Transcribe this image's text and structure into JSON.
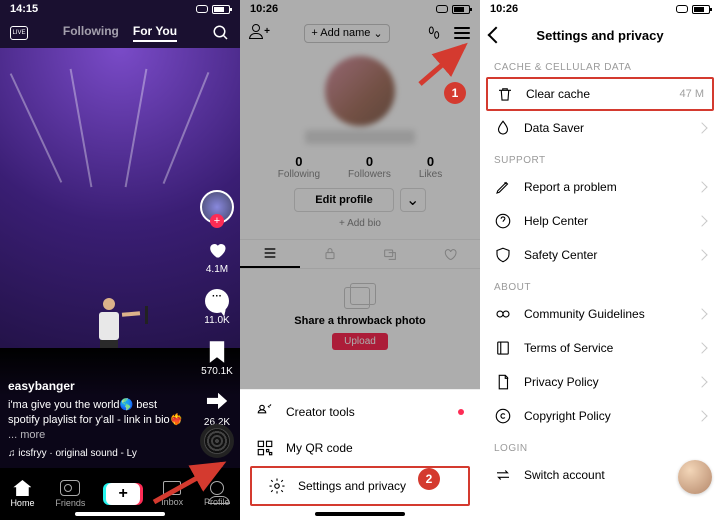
{
  "pane1": {
    "time": "14:15",
    "tabs": {
      "following": "Following",
      "foryou": "For You"
    },
    "rail": {
      "likes": "4.1M",
      "comments": "11.0K",
      "bookmarks": "570.1K",
      "shares": "26.2K"
    },
    "caption": {
      "user": "easybanger",
      "text": "i'ma give you the world🌎 best spotify playlist for y'all - link in bio❤️‍🔥 ",
      "more": "... more",
      "sound": "♫ icsfryy · original sound - Ly"
    },
    "nav": {
      "home": "Home",
      "friends": "Friends",
      "inbox": "Inbox",
      "profile": "Profile"
    }
  },
  "pane2": {
    "time": "10:26",
    "addname": "+ Add name",
    "stats": {
      "following_n": "0",
      "following_l": "Following",
      "followers_n": "0",
      "followers_l": "Followers",
      "likes_n": "0",
      "likes_l": "Likes"
    },
    "edit": "Edit profile",
    "addbio": "+ Add bio",
    "throw_title": "Share a throwback photo",
    "upload": "Upload",
    "sheet": {
      "creator": "Creator tools",
      "qrcode": "My QR code",
      "settings": "Settings and privacy"
    }
  },
  "pane3": {
    "time": "10:26",
    "title": "Settings and privacy",
    "sections": {
      "cache": "CACHE & CELLULAR DATA",
      "support": "SUPPORT",
      "about": "ABOUT",
      "login": "LOGIN"
    },
    "rows": {
      "clear_cache": "Clear cache",
      "clear_cache_val": "47 M",
      "data_saver": "Data Saver",
      "report": "Report a problem",
      "help": "Help Center",
      "safety": "Safety Center",
      "guidelines": "Community Guidelines",
      "terms": "Terms of Service",
      "privacy": "Privacy Policy",
      "copyright": "Copyright Policy",
      "switch": "Switch account"
    }
  },
  "annotations": {
    "step1": "1",
    "step2": "2"
  }
}
